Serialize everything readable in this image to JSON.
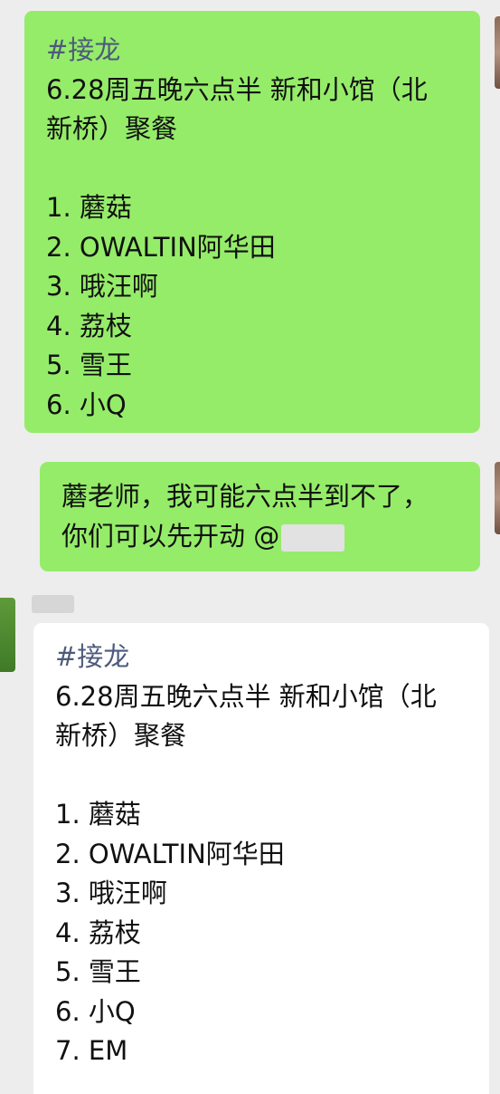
{
  "messages": [
    {
      "side": "right",
      "lines": [
        "#接龙",
        "6.28周五晚六点半 新和小馆（北",
        "新桥）聚餐",
        "",
        "1. 蘑菇",
        "2. OWALTIN阿华田",
        "3. 哦汪啊",
        "4. 荔枝",
        "5. 雪王",
        "6. 小Q"
      ]
    },
    {
      "side": "right",
      "lines": [
        "蘑老师，我可能六点半到不了，",
        "你们可以先开动 @"
      ]
    },
    {
      "side": "left",
      "lines": [
        "#接龙",
        "6.28周五晚六点半 新和小馆（北",
        "新桥）聚餐",
        "",
        "1. 蘑菇",
        "2. OWALTIN阿华田",
        "3. 哦汪啊",
        "4. 荔枝",
        "5. 雪王",
        "6. 小Q",
        "7. EM"
      ]
    }
  ],
  "colors": {
    "background": "#ededed",
    "own_bubble": "#95ec69",
    "other_bubble": "#ffffff",
    "hashtag": "#4d5a7c"
  }
}
